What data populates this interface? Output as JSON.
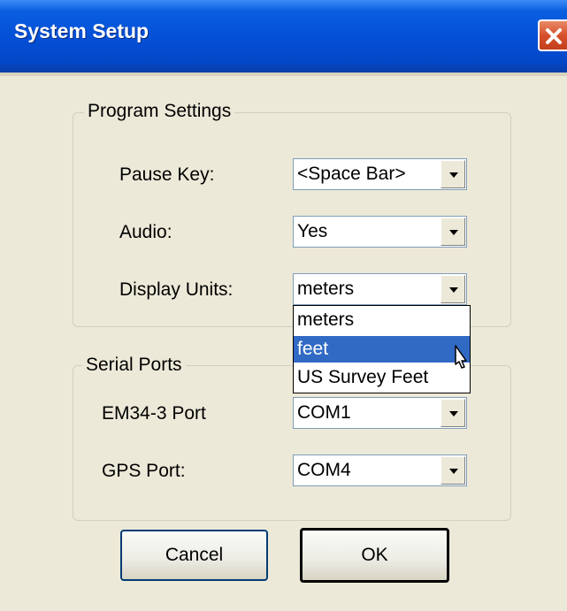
{
  "window": {
    "title": "System Setup"
  },
  "program_settings": {
    "title": "Program Settings",
    "pause_key": {
      "label": "Pause Key:",
      "value": "<Space Bar>"
    },
    "audio": {
      "label": "Audio:",
      "value": "Yes"
    },
    "display_units": {
      "label": "Display Units:",
      "value": "meters",
      "options": [
        "meters",
        "feet",
        "US Survey Feet"
      ],
      "highlighted": "feet"
    }
  },
  "serial_ports": {
    "title": "Serial Ports",
    "em34_port": {
      "label": "EM34-3 Port",
      "value": "COM1"
    },
    "gps_port": {
      "label": "GPS Port:",
      "value": "COM4"
    }
  },
  "buttons": {
    "cancel": "Cancel",
    "ok": "OK"
  },
  "icons": {
    "close": "close-icon",
    "dropdown": "chevron-down-icon",
    "cursor": "mouse-pointer-icon"
  },
  "colors": {
    "titlebar": "#0450d8",
    "close_button": "#d7502c",
    "selection": "#316ac5",
    "dialog_bg": "#ece9d8"
  }
}
